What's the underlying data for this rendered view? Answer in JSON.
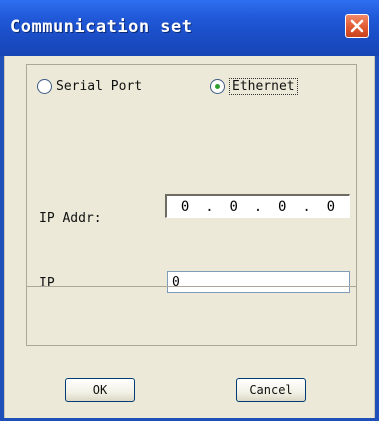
{
  "window": {
    "title": "Communication set",
    "close_icon": "close-icon"
  },
  "connection": {
    "options": [
      {
        "label": "Serial Port",
        "selected": false
      },
      {
        "label": "Ethernet",
        "selected": true
      }
    ]
  },
  "form": {
    "ip_addr_label": "IP Addr:",
    "ip_addr_octets": [
      "0",
      "0",
      "0",
      "0"
    ],
    "ip_label": "IP",
    "ip_value": "0"
  },
  "buttons": {
    "ok_label": "OK",
    "cancel_label": "Cancel"
  },
  "colors": {
    "titlebar": "#1f57d6",
    "dialog_bg": "#ece9d8",
    "close_button": "#e05a32",
    "radio_dot": "#2d9f2d"
  }
}
